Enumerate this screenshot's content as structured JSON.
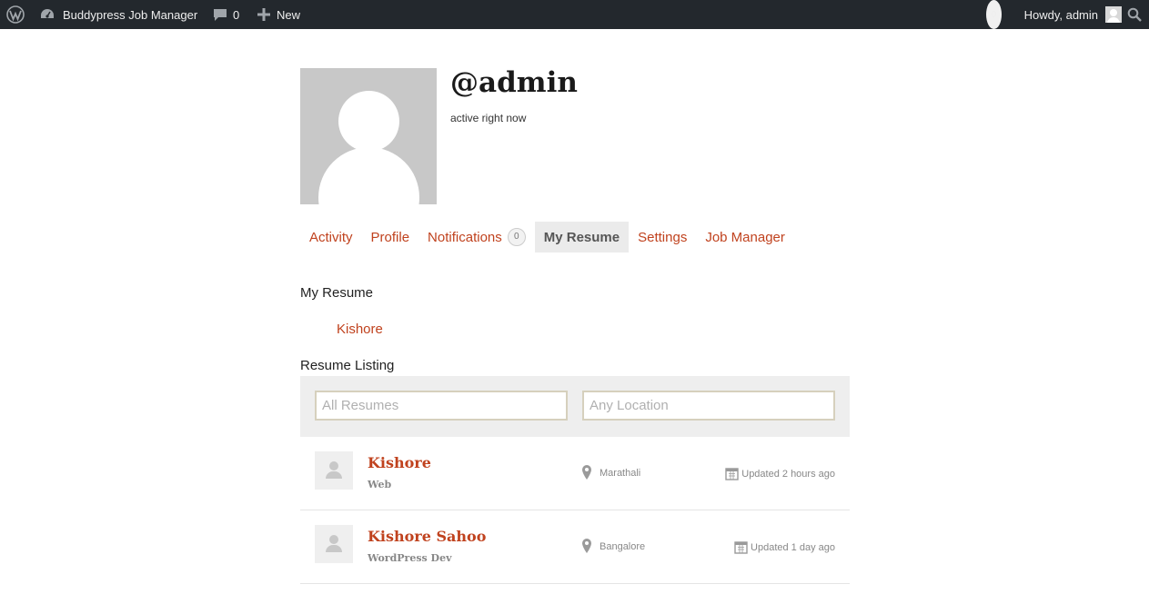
{
  "adminbar": {
    "site_name": "Buddypress Job Manager",
    "comments_count": "0",
    "new_label": "New",
    "notifications_count": "0",
    "howdy": "Howdy, admin"
  },
  "profile": {
    "username": "@admin",
    "activity": "active right now"
  },
  "nav": {
    "items": [
      {
        "label": "Activity"
      },
      {
        "label": "Profile"
      },
      {
        "label": "Notifications",
        "count": "0"
      },
      {
        "label": "My Resume",
        "current": true
      },
      {
        "label": "Settings"
      },
      {
        "label": "Job Manager"
      }
    ]
  },
  "content": {
    "my_resume_heading": "My Resume",
    "resume_link": "Kishore",
    "listing_heading": "Resume Listing",
    "keywords_placeholder": "All Resumes",
    "location_placeholder": "Any Location"
  },
  "resumes": [
    {
      "name": "Kishore",
      "title": "Web",
      "location": "Marathali",
      "updated": "Updated 2 hours ago"
    },
    {
      "name": "Kishore Sahoo",
      "title": "WordPress Dev",
      "location": "Bangalore",
      "updated": "Updated 1 day ago"
    }
  ],
  "colors": {
    "adminbar_bg": "#23282d",
    "link": "#c0421e",
    "current_tab_bg": "#ebebeb",
    "filter_bg": "#eeeeee",
    "input_border": "#d6d0bd"
  },
  "icons": {
    "wp_logo": "wordpress-icon",
    "site": "dashboard-icon",
    "comments": "comment-icon",
    "new": "plus-icon",
    "search": "search-icon",
    "location": "map-pin-icon",
    "updated": "calendar-icon"
  }
}
